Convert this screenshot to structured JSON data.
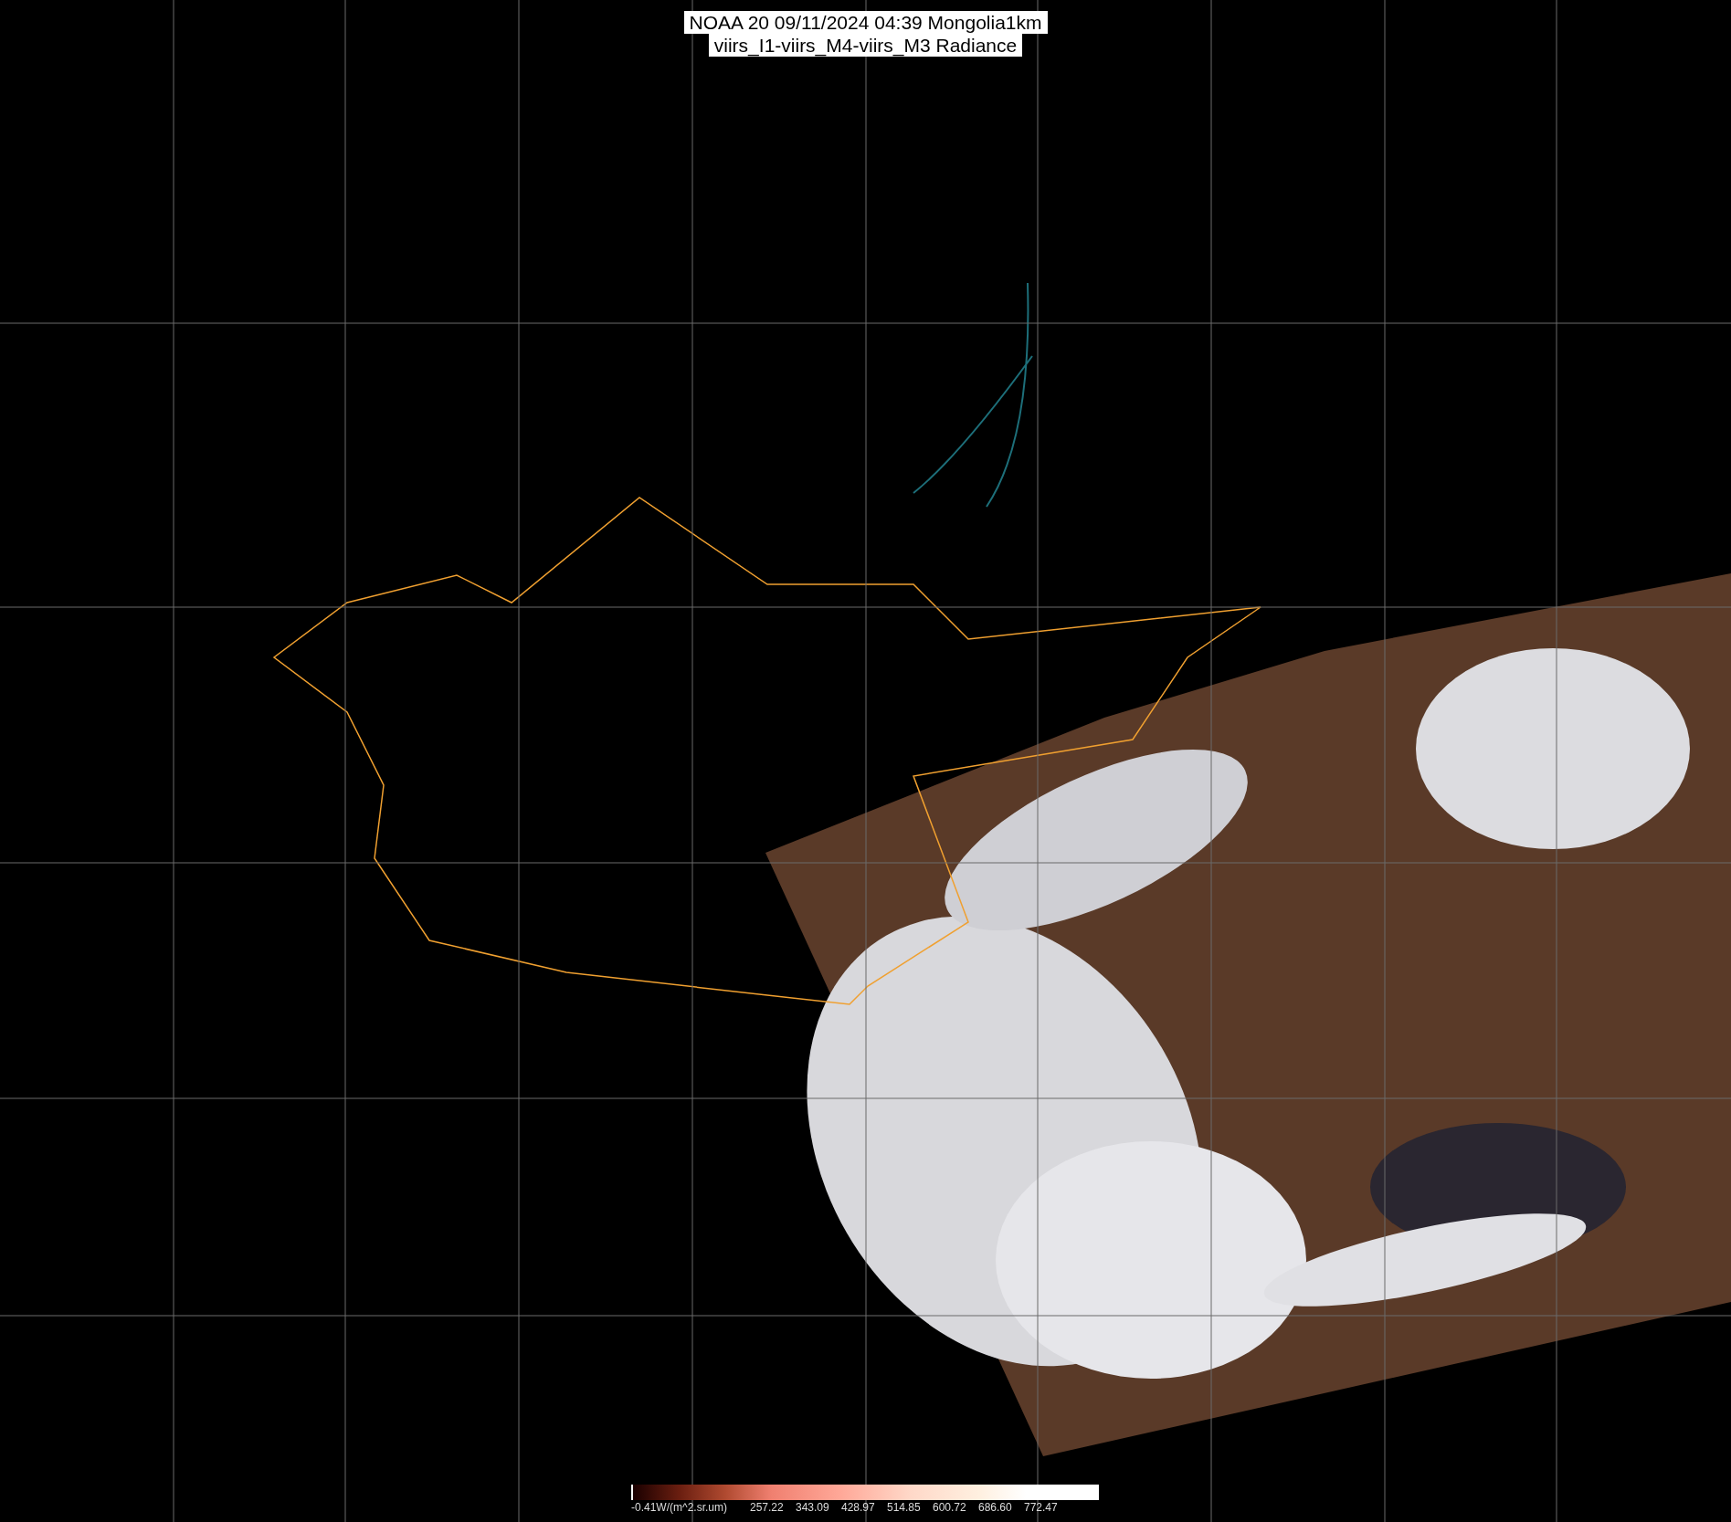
{
  "title": {
    "lines": [
      "NOAA 20 09/11/2024 04:39 Mongolia1km",
      "viirs_I1-viirs_M4-viirs_M3 Radiance"
    ]
  },
  "colorbar": {
    "labels": [
      "-0.41W/(m^2.sr.um)",
      "257.22",
      "343.09",
      "428.97",
      "514.85",
      "600.72",
      "686.60",
      "772.47"
    ]
  }
}
